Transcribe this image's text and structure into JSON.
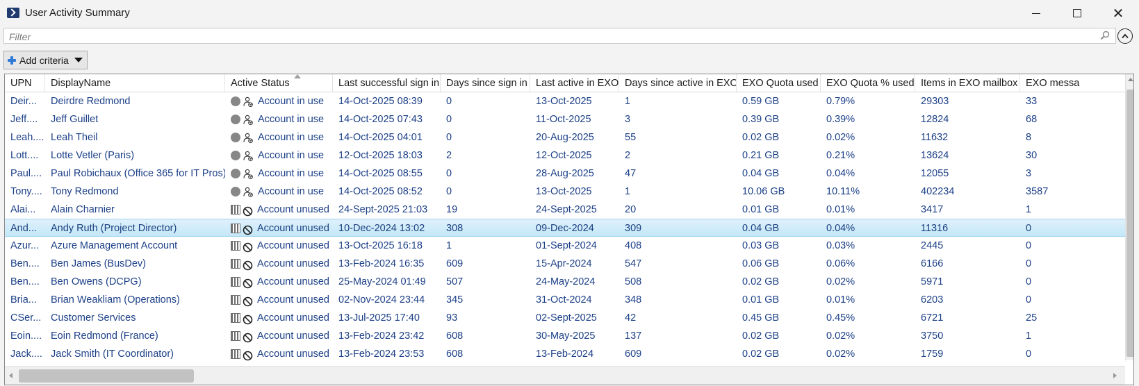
{
  "window": {
    "title": "User Activity Summary",
    "minimize_icon": "minimize-icon",
    "maximize_icon": "maximize-icon",
    "close_label": "✕"
  },
  "filter": {
    "placeholder": "Filter",
    "value": ""
  },
  "criteria": {
    "add_label": "Add criteria"
  },
  "columns": [
    "UPN",
    "DisplayName",
    "Active Status",
    "Last successful sign in",
    "Days since sign in",
    "Last active in EXO",
    "Days since active in EXO",
    "EXO Quota used",
    "EXO Quota % used",
    "Items in EXO mailbox",
    "EXO messa"
  ],
  "sorted_column": "Active Status",
  "rows": [
    {
      "upn": "Deir...",
      "display": "Deirdre Redmond",
      "status": "Account in use",
      "status_icon": "in-use",
      "last_sign_in": "14-Oct-2025 08:39",
      "days_sign": "0",
      "last_exo": "13-Oct-2025",
      "days_exo": "1",
      "quota": "0.59 GB",
      "quota_pct": "0.79%",
      "items": "29303",
      "msgs": "33"
    },
    {
      "upn": "Jeff....",
      "display": "Jeff Guillet",
      "status": "Account in use",
      "status_icon": "in-use",
      "last_sign_in": "14-Oct-2025 07:43",
      "days_sign": "0",
      "last_exo": "11-Oct-2025",
      "days_exo": "3",
      "quota": "0.39 GB",
      "quota_pct": "0.39%",
      "items": "12824",
      "msgs": "68"
    },
    {
      "upn": "Leah....",
      "display": "Leah Theil",
      "status": "Account in use",
      "status_icon": "in-use",
      "last_sign_in": "14-Oct-2025 04:01",
      "days_sign": "0",
      "last_exo": "20-Aug-2025",
      "days_exo": "55",
      "quota": "0.02 GB",
      "quota_pct": "0.02%",
      "items": "11632",
      "msgs": "8"
    },
    {
      "upn": "Lott....",
      "display": "Lotte Vetler (Paris)",
      "status": "Account in use",
      "status_icon": "in-use",
      "last_sign_in": "12-Oct-2025 18:03",
      "days_sign": "2",
      "last_exo": "12-Oct-2025",
      "days_exo": "2",
      "quota": "0.21 GB",
      "quota_pct": "0.21%",
      "items": "13624",
      "msgs": "30"
    },
    {
      "upn": "Paul....",
      "display": "Paul Robichaux (Office 365 for IT Pros)",
      "status": "Account in use",
      "status_icon": "in-use",
      "last_sign_in": "14-Oct-2025 08:55",
      "days_sign": "0",
      "last_exo": "28-Aug-2025",
      "days_exo": "47",
      "quota": "0.04 GB",
      "quota_pct": "0.04%",
      "items": "12055",
      "msgs": "3"
    },
    {
      "upn": "Tony....",
      "display": "Tony Redmond",
      "status": "Account in use",
      "status_icon": "in-use",
      "last_sign_in": "14-Oct-2025 08:52",
      "days_sign": "0",
      "last_exo": "13-Oct-2025",
      "days_exo": "1",
      "quota": "10.06 GB",
      "quota_pct": "10.11%",
      "items": "402234",
      "msgs": "3587"
    },
    {
      "upn": "Alai...",
      "display": "Alain Charnier",
      "status": "Account unused",
      "status_icon": "unused",
      "last_sign_in": "24-Sept-2025 21:03",
      "days_sign": "19",
      "last_exo": "24-Sept-2025",
      "days_exo": "20",
      "quota": "0.01 GB",
      "quota_pct": "0.01%",
      "items": "3417",
      "msgs": "1"
    },
    {
      "upn": "And...",
      "display": "Andy Ruth (Project Director)",
      "status": "Account unused",
      "status_icon": "unused",
      "last_sign_in": "10-Dec-2024 13:02",
      "days_sign": "308",
      "last_exo": "09-Dec-2024",
      "days_exo": "309",
      "quota": "0.04 GB",
      "quota_pct": "0.04%",
      "items": "11316",
      "msgs": "0",
      "selected": true
    },
    {
      "upn": "Azur...",
      "display": "Azure Management Account",
      "status": "Account unused",
      "status_icon": "unused",
      "last_sign_in": "13-Oct-2025 16:18",
      "days_sign": "1",
      "last_exo": "01-Sept-2024",
      "days_exo": "408",
      "quota": "0.03 GB",
      "quota_pct": "0.03%",
      "items": "2445",
      "msgs": "0"
    },
    {
      "upn": "Ben....",
      "display": "Ben James (BusDev)",
      "status": "Account unused",
      "status_icon": "unused",
      "last_sign_in": "13-Feb-2024 16:35",
      "days_sign": "609",
      "last_exo": "15-Apr-2024",
      "days_exo": "547",
      "quota": "0.06 GB",
      "quota_pct": "0.06%",
      "items": "6166",
      "msgs": "0"
    },
    {
      "upn": "Ben....",
      "display": "Ben Owens (DCPG)",
      "status": "Account unused",
      "status_icon": "unused",
      "last_sign_in": "25-May-2024 01:49",
      "days_sign": "507",
      "last_exo": "24-May-2024",
      "days_exo": "508",
      "quota": "0.02 GB",
      "quota_pct": "0.02%",
      "items": "5971",
      "msgs": "0"
    },
    {
      "upn": "Bria...",
      "display": "Brian Weakliam (Operations)",
      "status": "Account unused",
      "status_icon": "unused",
      "last_sign_in": "02-Nov-2024 23:44",
      "days_sign": "345",
      "last_exo": "31-Oct-2024",
      "days_exo": "348",
      "quota": "0.01 GB",
      "quota_pct": "0.01%",
      "items": "6203",
      "msgs": "0"
    },
    {
      "upn": "CSer...",
      "display": "Customer Services",
      "status": "Account unused",
      "status_icon": "unused",
      "last_sign_in": "13-Jul-2025 17:40",
      "days_sign": "93",
      "last_exo": "02-Sept-2025",
      "days_exo": "42",
      "quota": "0.45 GB",
      "quota_pct": "0.45%",
      "items": "6721",
      "msgs": "25"
    },
    {
      "upn": "Eoin....",
      "display": "Eoin Redmond (France)",
      "status": "Account unused",
      "status_icon": "unused",
      "last_sign_in": "13-Feb-2024 23:42",
      "days_sign": "608",
      "last_exo": "30-May-2025",
      "days_exo": "137",
      "quota": "0.02 GB",
      "quota_pct": "0.02%",
      "items": "3750",
      "msgs": "1"
    },
    {
      "upn": "Jack....",
      "display": "Jack Smith (IT Coordinator)",
      "status": "Account unused",
      "status_icon": "unused",
      "last_sign_in": "13-Feb-2024 23:53",
      "days_sign": "608",
      "last_exo": "13-Feb-2024",
      "days_exo": "609",
      "quota": "0.02 GB",
      "quota_pct": "0.02%",
      "items": "1759",
      "msgs": "0"
    }
  ]
}
